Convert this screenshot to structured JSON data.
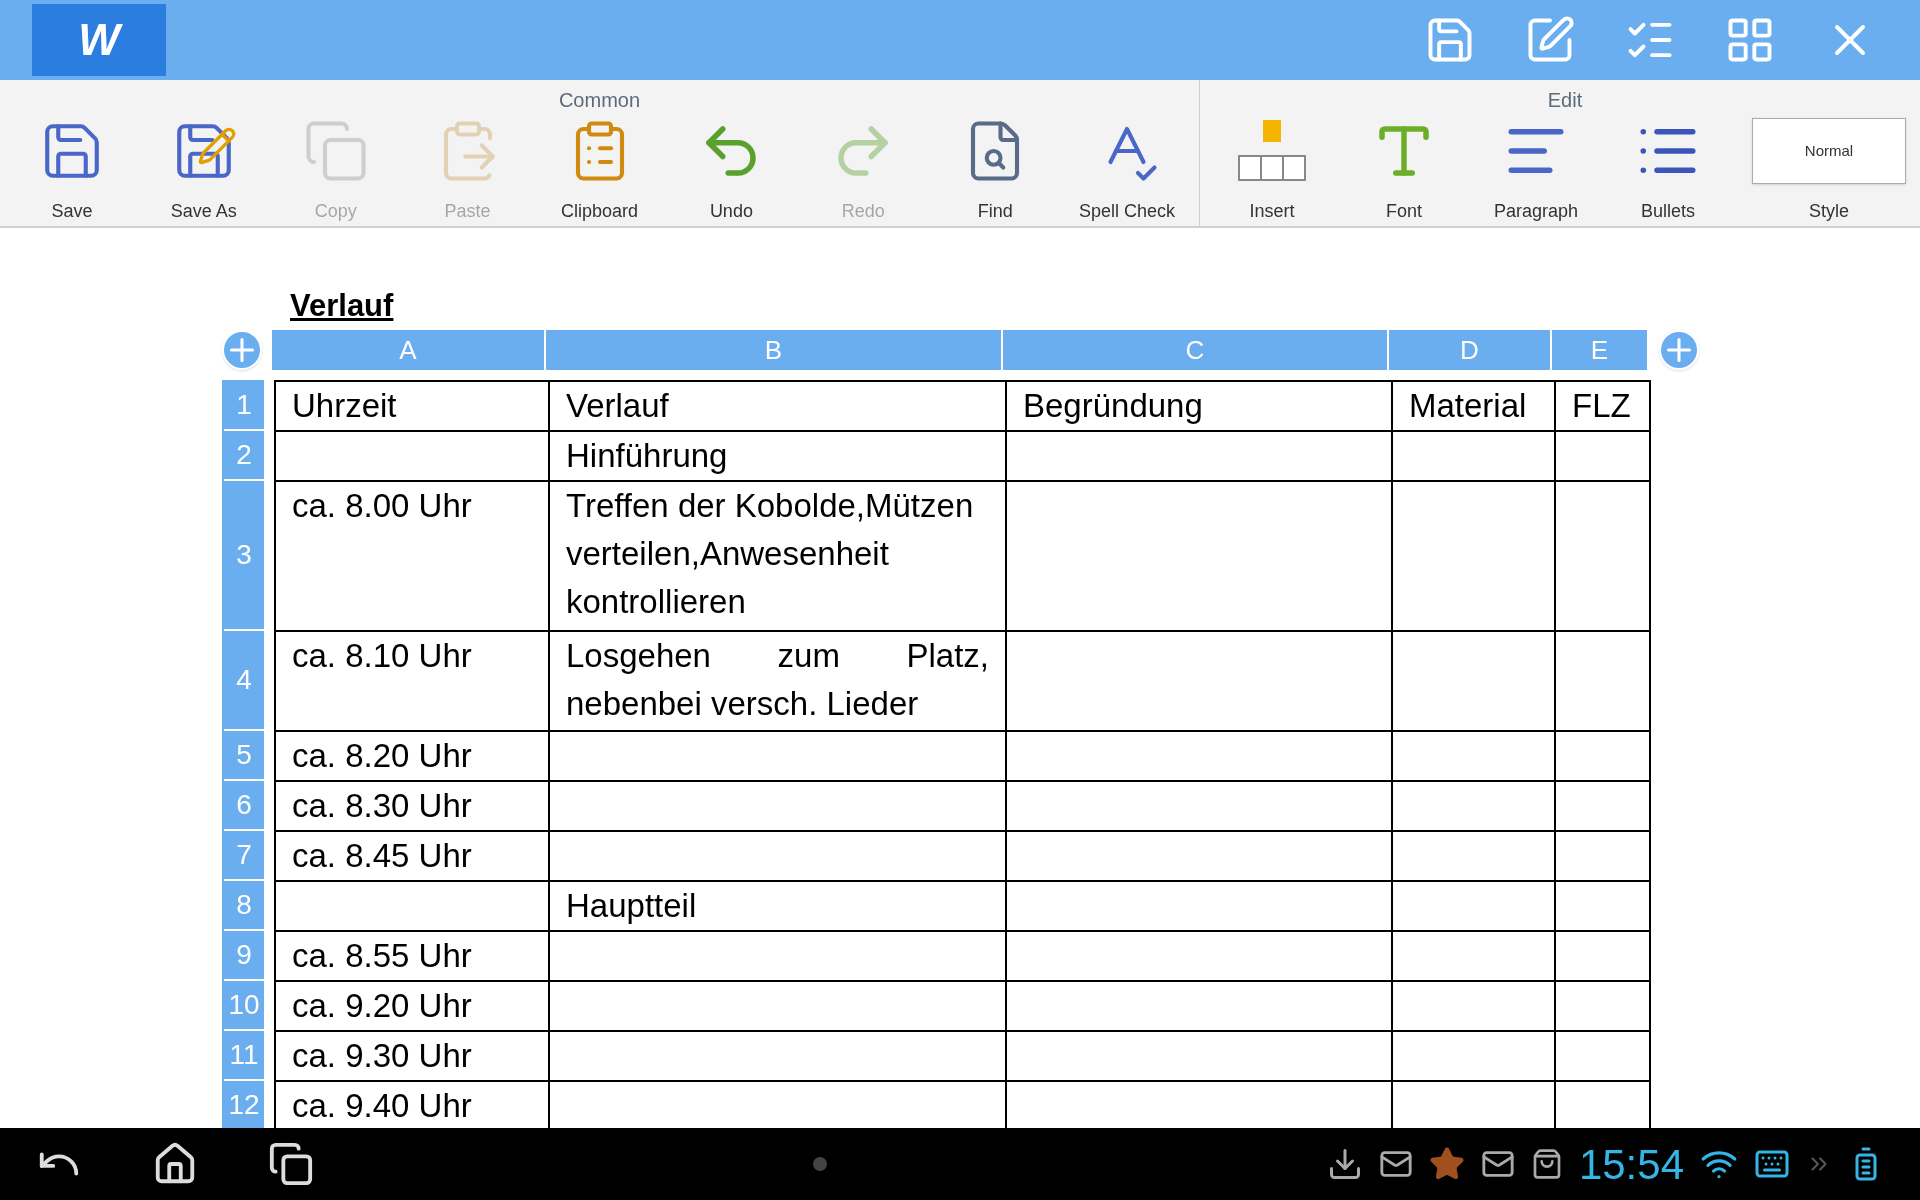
{
  "app_bar": {
    "logo": "W"
  },
  "toolbar": {
    "groups": [
      {
        "label": "Common",
        "items": [
          {
            "label": "Save",
            "kind": "save",
            "disabled": false
          },
          {
            "label": "Save As",
            "kind": "save_as",
            "disabled": false
          },
          {
            "label": "Copy",
            "kind": "copy",
            "disabled": true
          },
          {
            "label": "Paste",
            "kind": "paste",
            "disabled": true
          },
          {
            "label": "Clipboard",
            "kind": "clipboard",
            "disabled": false
          },
          {
            "label": "Undo",
            "kind": "undo",
            "disabled": false
          },
          {
            "label": "Redo",
            "kind": "redo",
            "disabled": true
          },
          {
            "label": "Find",
            "kind": "find",
            "disabled": false
          },
          {
            "label": "Spell Check",
            "kind": "spell",
            "disabled": false
          }
        ]
      },
      {
        "label": "Edit",
        "items": [
          {
            "label": "Insert",
            "kind": "insert",
            "disabled": false
          },
          {
            "label": "Font",
            "kind": "font",
            "disabled": false
          },
          {
            "label": "Paragraph",
            "kind": "paragraph",
            "disabled": false
          },
          {
            "label": "Bullets",
            "kind": "bullets",
            "disabled": false
          },
          {
            "label": "Style",
            "kind": "style",
            "preview": "Normal",
            "disabled": false
          }
        ]
      }
    ]
  },
  "document": {
    "heading": "Verlauf",
    "table": {
      "columns": [
        "A",
        "B",
        "C",
        "D",
        "E"
      ],
      "rows": [
        {
          "number": "1",
          "cells": [
            "Uhrzeit",
            "Verlauf",
            "Begründung",
            "Material",
            "FLZ"
          ]
        },
        {
          "number": "2",
          "cells": [
            "",
            "Hinführung",
            "",
            "",
            ""
          ]
        },
        {
          "number": "3",
          "cells": [
            "ca. 8.00 Uhr",
            "Treffen der Kobolde,Mützen verteilen,Anwesenheit kontrollieren",
            "",
            "",
            ""
          ]
        },
        {
          "number": "4",
          "cells": [
            "ca. 8.10 Uhr",
            "Losgehen zum Platz, nebenbei versch. Lieder",
            "",
            "",
            ""
          ]
        },
        {
          "number": "5",
          "cells": [
            "ca. 8.20 Uhr",
            "",
            "",
            "",
            ""
          ]
        },
        {
          "number": "6",
          "cells": [
            "ca. 8.30 Uhr",
            "",
            "",
            "",
            ""
          ]
        },
        {
          "number": "7",
          "cells": [
            "ca. 8.45 Uhr",
            "",
            "",
            "",
            ""
          ]
        },
        {
          "number": "8",
          "cells": [
            "",
            "Hauptteil",
            "",
            "",
            ""
          ]
        },
        {
          "number": "9",
          "cells": [
            "ca. 8.55 Uhr",
            "",
            "",
            "",
            ""
          ]
        },
        {
          "number": "10",
          "cells": [
            "ca. 9.20 Uhr",
            "",
            "",
            "",
            ""
          ]
        },
        {
          "number": "11",
          "cells": [
            "ca. 9.30 Uhr",
            "",
            "",
            "",
            ""
          ]
        },
        {
          "number": "12",
          "cells": [
            "ca. 9.40 Uhr",
            "",
            "",
            "",
            ""
          ]
        }
      ]
    }
  },
  "status_bar": {
    "time": "15:54"
  }
}
